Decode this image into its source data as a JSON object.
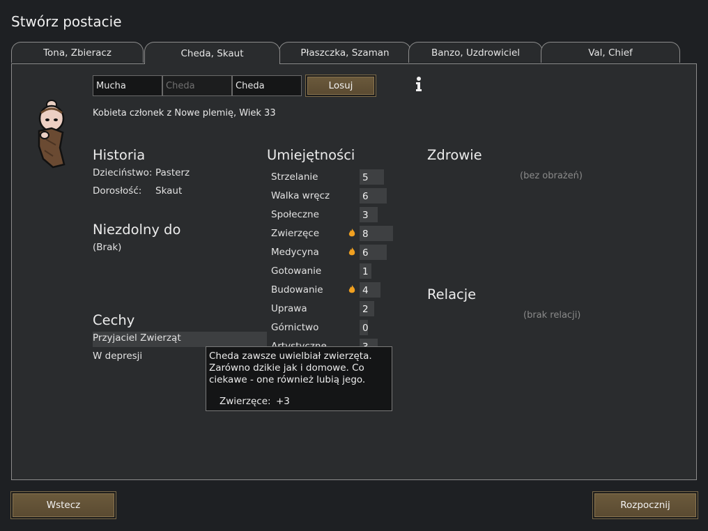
{
  "window": {
    "title": "Stwórz postacie"
  },
  "tabs": [
    {
      "label": "Tona, Zbieracz",
      "active": false
    },
    {
      "label": "Cheda, Skaut",
      "active": true
    },
    {
      "label": "Płaszczka, Szaman",
      "active": false
    },
    {
      "label": "Banzo, Uzdrowiciel",
      "active": false
    },
    {
      "label": "Val, Chief",
      "active": false
    }
  ],
  "name": {
    "first": "Mucha",
    "nick_placeholder": "Cheda",
    "last": "Cheda",
    "randomize_label": "Losuj"
  },
  "info_icon": "info-icon",
  "description": "Kobieta członek z Nowe plemię, Wiek 33",
  "history": {
    "title": "Historia",
    "childhood_label": "Dzieciństwo:",
    "childhood_value": "Pasterz",
    "adulthood_label": "Dorosłość:",
    "adulthood_value": "Skaut"
  },
  "incapable": {
    "title": "Niezdolny do",
    "value": "(Brak)"
  },
  "traits": {
    "title": "Cechy",
    "items": [
      "Przyjaciel Zwierząt",
      "W depresji"
    ]
  },
  "skills": {
    "title": "Umiejętności",
    "items": [
      {
        "name": "Strzelanie",
        "level": 5,
        "passion": false
      },
      {
        "name": "Walka wręcz",
        "level": 6,
        "passion": false
      },
      {
        "name": "Społeczne",
        "level": 3,
        "passion": false
      },
      {
        "name": "Zwierzęce",
        "level": 8,
        "passion": true
      },
      {
        "name": "Medycyna",
        "level": 6,
        "passion": true
      },
      {
        "name": "Gotowanie",
        "level": 1,
        "passion": false
      },
      {
        "name": "Budowanie",
        "level": 4,
        "passion": true
      },
      {
        "name": "Uprawa",
        "level": 2,
        "passion": false
      },
      {
        "name": "Górnictwo",
        "level": 0,
        "passion": false
      },
      {
        "name": "Artystyczne",
        "level": 3,
        "passion": false
      }
    ]
  },
  "health": {
    "title": "Zdrowie",
    "status": "(bez obrażeń)"
  },
  "relations": {
    "title": "Relacje",
    "status": "(brak relacji)"
  },
  "tooltip": {
    "lines": [
      "Cheda zawsze uwielbiał zwierzęta.",
      "Zarówno dzikie jak i domowe. Co",
      "ciekawe - one również lubią jego."
    ],
    "modifier_label": "Zwierzęce:",
    "modifier_value": "+3"
  },
  "footer": {
    "back_label": "Wstecz",
    "start_label": "Rozpocznij"
  },
  "colors": {
    "button": "#5f4f35",
    "panel": "#2a2c2e",
    "background": "#1e2023",
    "passion": "#f0a020"
  }
}
